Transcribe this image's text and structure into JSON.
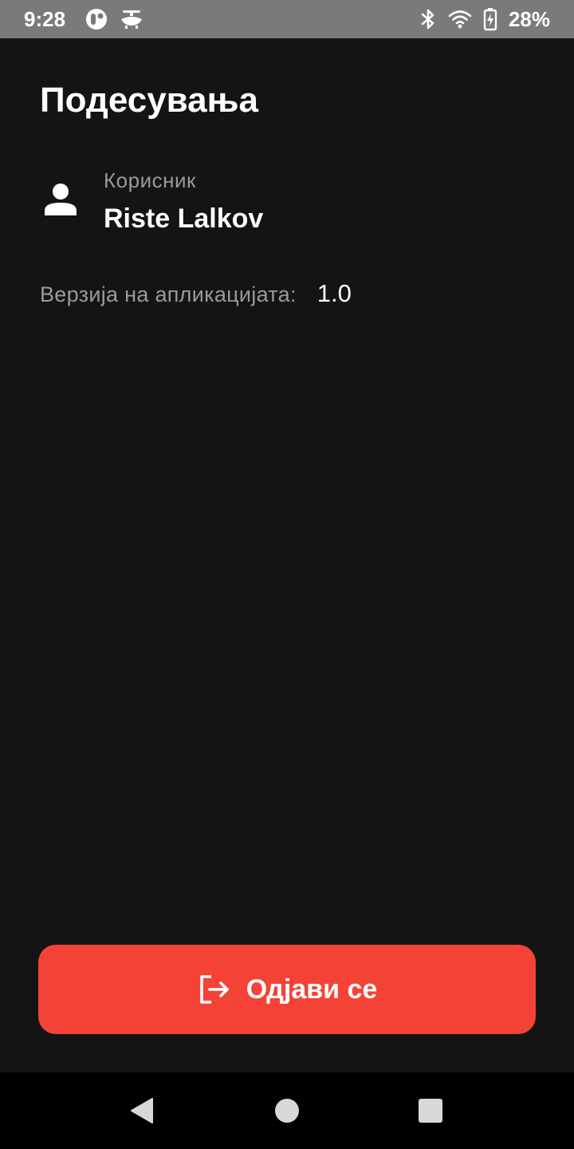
{
  "status_bar": {
    "time": "9:28",
    "battery_percent": "28%",
    "icons": [
      "app-notification-icon",
      "drone-icon",
      "bluetooth-icon",
      "wifi-icon",
      "battery-charging-icon"
    ]
  },
  "settings": {
    "title": "Подесувања",
    "user": {
      "caption": "Корисник",
      "name": "Riste Lalkov",
      "icon": "person-icon"
    },
    "version": {
      "label": "Верзија на апликацијата:",
      "value": "1.0"
    }
  },
  "logout": {
    "label": "Одјави се",
    "icon": "logout-icon",
    "color": "#f44336"
  },
  "nav_bar": {
    "buttons": [
      "back-icon",
      "home-icon",
      "recents-icon"
    ]
  }
}
